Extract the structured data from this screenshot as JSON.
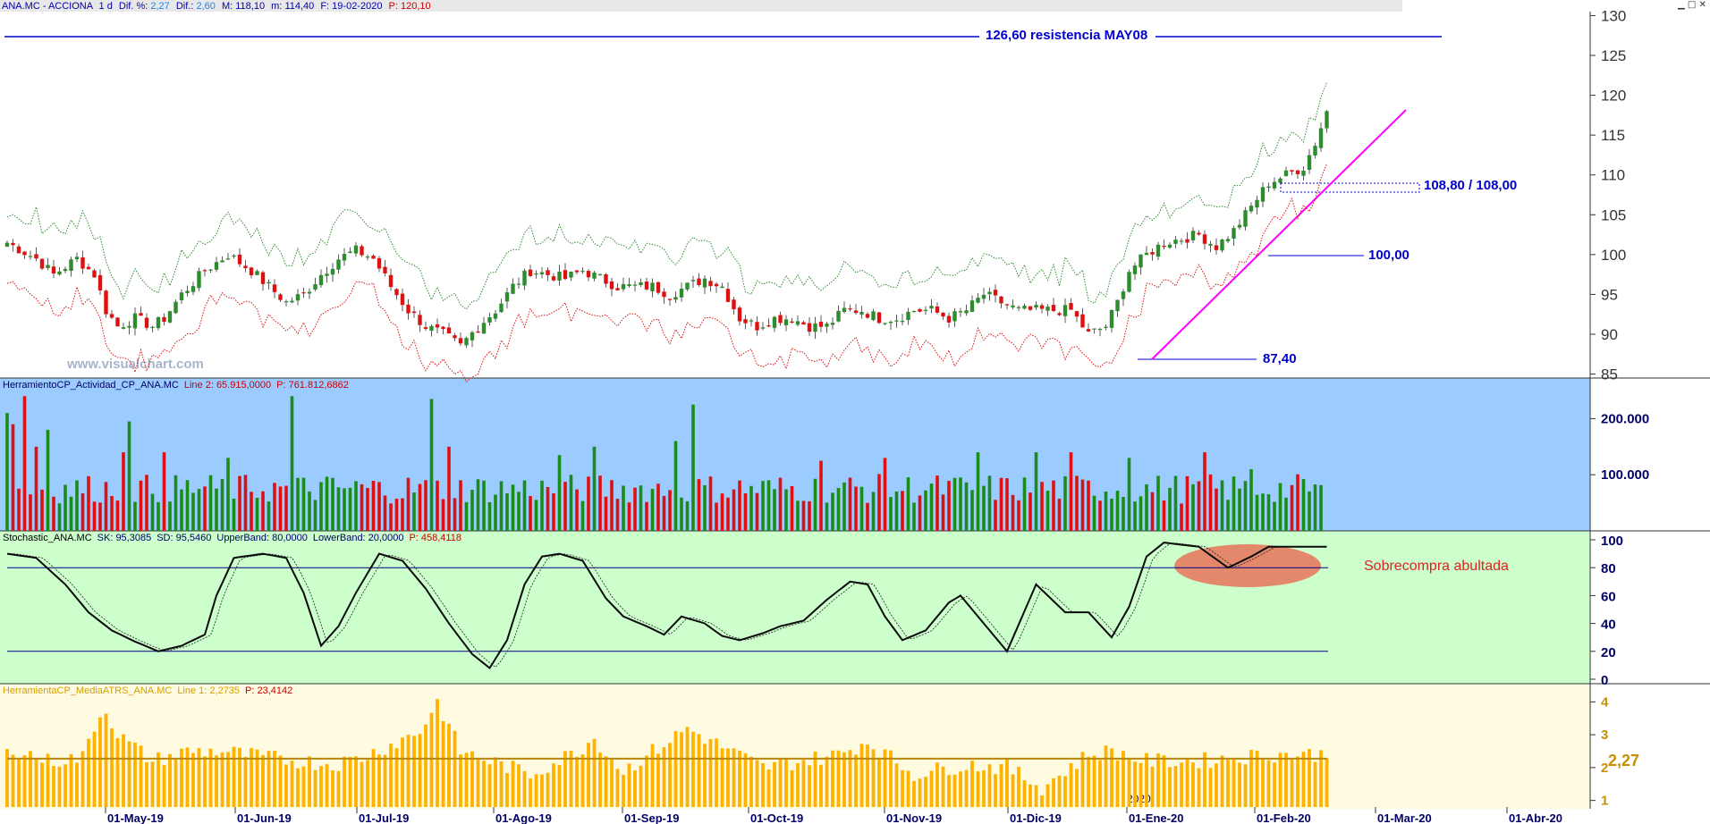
{
  "header": {
    "symbol": "ANA.MC - ACCIONA",
    "period": "1 d",
    "dif_pct_label": "Dif. %:",
    "dif_pct": "2,27",
    "dif_label": "Dif.:",
    "dif": "2,60",
    "max_label": "M:",
    "max": "118,10",
    "min_label": "m:",
    "min": "114,40",
    "date_label": "F:",
    "date": "19-02-2020",
    "price_label": "P:",
    "price": "120,10"
  },
  "watermark": "www.visualchart.com",
  "window_controls": [
    "▁",
    "□",
    "✕"
  ],
  "panels": {
    "volume": {
      "title": "HerramientoCP_Actividad_CP_ANA.MC",
      "line_label": "Line 2: 65.915,0000",
      "p_label": "P: 761.812,6862"
    },
    "stochastic": {
      "title": "Stochastic_ANA.MC",
      "sk": "SK: 95,3085",
      "sd": "SD: 95,5460",
      "upper": "UpperBand: 80,0000",
      "lower": "LowerBand: 20,0000",
      "p_label": "P: 458,4118",
      "annotation": "Sobrecompra abultada"
    },
    "atr": {
      "title": "HerramientaCP_MediaATRS_ANA.MC",
      "line_label": "Line 1: 2,2735",
      "p_label": "P: 23,4142",
      "current": "2,27",
      "year_marker": "2020"
    }
  },
  "annotations": {
    "resistance": "126,60 resistencia MAY08",
    "support_zone": "108,80 / 108,00",
    "level_100": "100,00",
    "level_low": "87,40"
  },
  "colors": {
    "up": "#2e8b2e",
    "down": "#dd1111",
    "label_blue": "#0000cc",
    "trendline": "#ff00ff",
    "volume_bg": "#9ccbff",
    "stoch_bg": "#ccffcc",
    "atr_bg": "#fffbe0",
    "atr_bar": "#ffb300",
    "atr_line": "#b8860b",
    "overbought_ellipse": "#e8735a"
  },
  "chart_data": [
    {
      "type": "candlestick",
      "title": "ANA.MC - ACCIONA",
      "x_labels": [
        "01-May-19",
        "01-Jun-19",
        "01-Jul-19",
        "01-Ago-19",
        "01-Sep-19",
        "01-Oct-19",
        "01-Nov-19",
        "01-Dic-19",
        "01-Ene-20",
        "01-Feb-20",
        "01-Mar-20",
        "01-Abr-20"
      ],
      "y_ticks": [
        85,
        90,
        95,
        100,
        105,
        110,
        115,
        120,
        125,
        130
      ],
      "ylim": [
        84.5,
        130.5
      ],
      "close_path": [
        [
          0,
          101.5
        ],
        [
          5,
          99.5
        ],
        [
          8,
          97.5
        ],
        [
          12,
          99.5
        ],
        [
          15,
          97.5
        ],
        [
          17,
          93.0
        ],
        [
          19,
          91.0
        ],
        [
          22,
          92.0
        ],
        [
          25,
          91.0
        ],
        [
          27,
          92.0
        ],
        [
          30,
          95.0
        ],
        [
          34,
          98.0
        ],
        [
          38,
          100.0
        ],
        [
          42,
          98.0
        ],
        [
          45,
          96.0
        ],
        [
          48,
          94.0
        ],
        [
          51,
          95.0
        ],
        [
          54,
          97.5
        ],
        [
          57,
          99.5
        ],
        [
          60,
          100.5
        ],
        [
          63,
          99.5
        ],
        [
          66,
          96.0
        ],
        [
          69,
          93.0
        ],
        [
          72,
          91.0
        ],
        [
          75,
          90.0
        ],
        [
          78,
          88.5
        ],
        [
          81,
          91.0
        ],
        [
          84,
          93.0
        ],
        [
          87,
          96.0
        ],
        [
          90,
          98.0
        ],
        [
          93,
          97.5
        ],
        [
          96,
          97.0
        ],
        [
          99,
          98.0
        ],
        [
          102,
          97.0
        ],
        [
          105,
          96.0
        ],
        [
          108,
          96.0
        ],
        [
          111,
          96.0
        ],
        [
          114,
          95.0
        ],
        [
          117,
          96.0
        ],
        [
          120,
          97.0
        ],
        [
          123,
          96.0
        ],
        [
          126,
          92.0
        ],
        [
          129,
          91.0
        ],
        [
          132,
          92.0
        ],
        [
          135,
          92.0
        ],
        [
          138,
          91.0
        ],
        [
          141,
          91.0
        ],
        [
          144,
          93.0
        ],
        [
          147,
          93.0
        ],
        [
          150,
          92.0
        ],
        [
          153,
          92.0
        ],
        [
          156,
          93.0
        ],
        [
          159,
          93.0
        ],
        [
          162,
          92.0
        ],
        [
          165,
          93.0
        ],
        [
          168,
          95.0
        ],
        [
          171,
          94.0
        ],
        [
          174,
          93.0
        ],
        [
          177,
          93.0
        ],
        [
          180,
          93.0
        ],
        [
          183,
          93.0
        ],
        [
          186,
          90.0
        ],
        [
          189,
          91.0
        ],
        [
          191,
          94.0
        ],
        [
          193,
          98.0
        ],
        [
          196,
          100.0
        ],
        [
          199,
          101.5
        ],
        [
          202,
          102.0
        ],
        [
          205,
          102.5
        ],
        [
          208,
          101.0
        ],
        [
          211,
          103.0
        ],
        [
          214,
          106.0
        ],
        [
          217,
          109.0
        ],
        [
          220,
          110.0
        ],
        [
          223,
          111.0
        ],
        [
          225,
          114.0
        ],
        [
          227,
          118.0
        ]
      ],
      "bands_offset": 4.0
    },
    {
      "type": "bar",
      "name": "HerramientoCP_Actividad_CP_ANA.MC",
      "y_ticks": [
        "100.000",
        "200.000"
      ],
      "tick_values": [
        100000,
        200000
      ],
      "ylim": [
        0,
        250000
      ],
      "spikes": [
        [
          0,
          210000
        ],
        [
          1,
          190000
        ],
        [
          3,
          240000
        ],
        [
          5,
          150000
        ],
        [
          7,
          180000
        ],
        [
          20,
          140000
        ],
        [
          21,
          195000
        ],
        [
          27,
          140000
        ],
        [
          38,
          130000
        ],
        [
          49,
          240000
        ],
        [
          73,
          235000
        ],
        [
          76,
          150000
        ],
        [
          95,
          135000
        ],
        [
          101,
          150000
        ],
        [
          115,
          160000
        ],
        [
          118,
          225000
        ],
        [
          140,
          125000
        ],
        [
          151,
          130000
        ],
        [
          167,
          140000
        ],
        [
          177,
          140000
        ],
        [
          183,
          140000
        ],
        [
          193,
          130000
        ],
        [
          206,
          140000
        ],
        [
          214,
          110000
        ]
      ],
      "base_level": 75000
    },
    {
      "type": "line",
      "name": "Stochastic_ANA.MC",
      "y_ticks": [
        0,
        20,
        40,
        60,
        80,
        100
      ],
      "ylim": [
        0,
        100
      ],
      "bands": [
        80,
        20
      ],
      "sk_path": [
        [
          0,
          90
        ],
        [
          5,
          87
        ],
        [
          10,
          68
        ],
        [
          14,
          48
        ],
        [
          18,
          35
        ],
        [
          22,
          27
        ],
        [
          26,
          20
        ],
        [
          30,
          24
        ],
        [
          34,
          32
        ],
        [
          36,
          60
        ],
        [
          39,
          87
        ],
        [
          44,
          90
        ],
        [
          48,
          87
        ],
        [
          51,
          62
        ],
        [
          54,
          24
        ],
        [
          57,
          38
        ],
        [
          60,
          62
        ],
        [
          64,
          90
        ],
        [
          68,
          85
        ],
        [
          72,
          65
        ],
        [
          76,
          40
        ],
        [
          80,
          18
        ],
        [
          83,
          8
        ],
        [
          86,
          28
        ],
        [
          89,
          68
        ],
        [
          92,
          88
        ],
        [
          95,
          90
        ],
        [
          99,
          85
        ],
        [
          103,
          58
        ],
        [
          106,
          45
        ],
        [
          110,
          38
        ],
        [
          113,
          32
        ],
        [
          116,
          45
        ],
        [
          120,
          40
        ],
        [
          123,
          31
        ],
        [
          126,
          28
        ],
        [
          130,
          33
        ],
        [
          133,
          38
        ],
        [
          137,
          42
        ],
        [
          141,
          57
        ],
        [
          145,
          70
        ],
        [
          148,
          68
        ],
        [
          151,
          45
        ],
        [
          154,
          28
        ],
        [
          158,
          35
        ],
        [
          162,
          55
        ],
        [
          164,
          60
        ],
        [
          168,
          40
        ],
        [
          172,
          20
        ],
        [
          177,
          68
        ],
        [
          182,
          48
        ],
        [
          186,
          48
        ],
        [
          190,
          30
        ],
        [
          193,
          52
        ],
        [
          196,
          88
        ],
        [
          199,
          98
        ],
        [
          205,
          95
        ],
        [
          210,
          80
        ],
        [
          214,
          88
        ],
        [
          217,
          95
        ],
        [
          222,
          95
        ]
      ],
      "sd_offset": 1.2
    },
    {
      "type": "bar",
      "name": "HerramientaCP_MediaATRS_ANA.MC",
      "y_ticks": [
        1,
        2,
        3,
        4
      ],
      "ylim": [
        0.8,
        4.2
      ],
      "average_line": 2.2735,
      "bumps": [
        [
          1,
          2.6
        ],
        [
          7,
          2.2
        ],
        [
          13,
          2.3
        ],
        [
          15,
          3.3
        ],
        [
          17,
          3.8
        ],
        [
          19,
          3.0
        ],
        [
          25,
          2.2
        ],
        [
          31,
          2.5
        ],
        [
          37,
          2.5
        ],
        [
          45,
          2.3
        ],
        [
          56,
          2.1
        ],
        [
          61,
          2.3
        ],
        [
          71,
          3.1
        ],
        [
          74,
          4.0
        ],
        [
          78,
          2.5
        ],
        [
          90,
          1.8
        ],
        [
          98,
          2.5
        ],
        [
          101,
          2.9
        ],
        [
          106,
          1.9
        ],
        [
          112,
          2.6
        ],
        [
          117,
          3.2
        ],
        [
          119,
          3.0
        ],
        [
          130,
          2.0
        ],
        [
          143,
          2.4
        ],
        [
          148,
          2.8
        ],
        [
          156,
          1.8
        ],
        [
          165,
          2.1
        ],
        [
          172,
          2.0
        ],
        [
          178,
          1.4
        ],
        [
          186,
          2.4
        ],
        [
          190,
          2.5
        ],
        [
          196,
          2.2
        ],
        [
          205,
          2.2
        ],
        [
          217,
          2.4
        ],
        [
          222,
          2.4
        ]
      ]
    }
  ]
}
